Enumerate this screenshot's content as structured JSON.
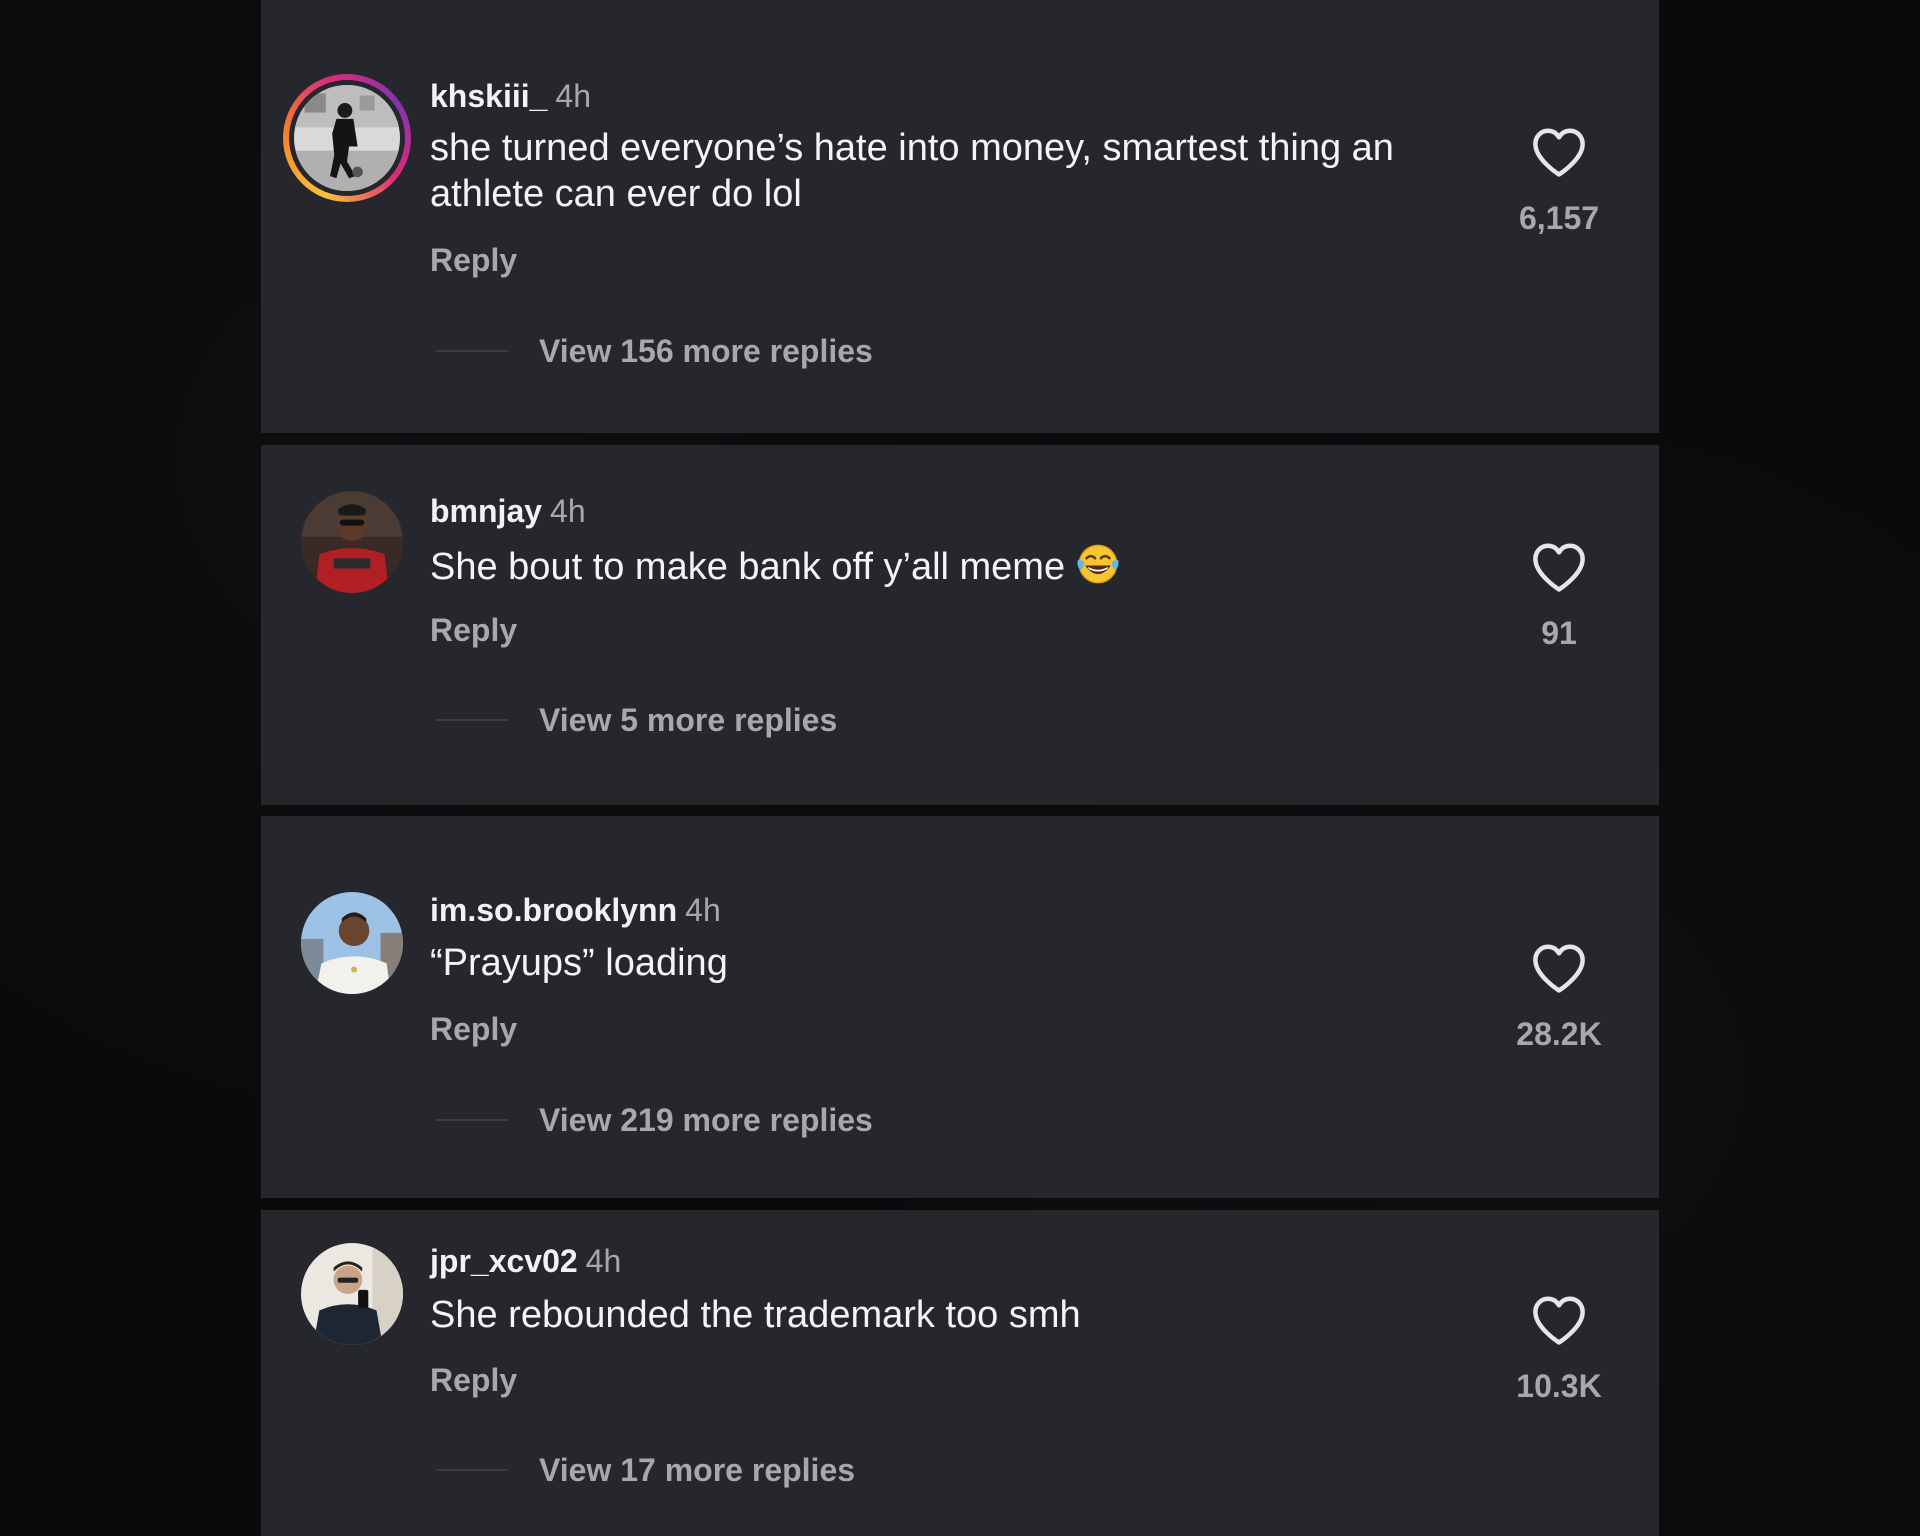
{
  "comments": [
    {
      "username": "khskiii_",
      "time": "4h",
      "text": "she turned everyone’s hate into money, smartest thing an athlete can ever do lol",
      "reply_label": "Reply",
      "view_replies": "View 156 more replies",
      "likes": "6,157",
      "avatar_story_ring": true
    },
    {
      "username": "bmnjay",
      "time": "4h",
      "text": "She bout to make bank off y’all meme",
      "emoji": "face-with-tears-of-joy",
      "reply_label": "Reply",
      "view_replies": "View 5 more replies",
      "likes": "91",
      "avatar_story_ring": false
    },
    {
      "username": "im.so.brooklynn",
      "time": "4h",
      "text": "“Prayups” loading",
      "reply_label": "Reply",
      "view_replies": "View 219 more replies",
      "likes": "28.2K",
      "avatar_story_ring": false
    },
    {
      "username": "jpr_xcv02",
      "time": "4h",
      "text": "She rebounded the trademark too smh",
      "reply_label": "Reply",
      "view_replies": "View 17 more replies",
      "likes": "10.3K",
      "avatar_story_ring": false
    }
  ],
  "icons": {
    "like": "heart-outline-icon"
  },
  "colors": {
    "card_background": "#25272d",
    "page_background": "#0a0a0b",
    "primary_text": "#f4f4f6",
    "secondary_text": "#a6a8ae"
  }
}
